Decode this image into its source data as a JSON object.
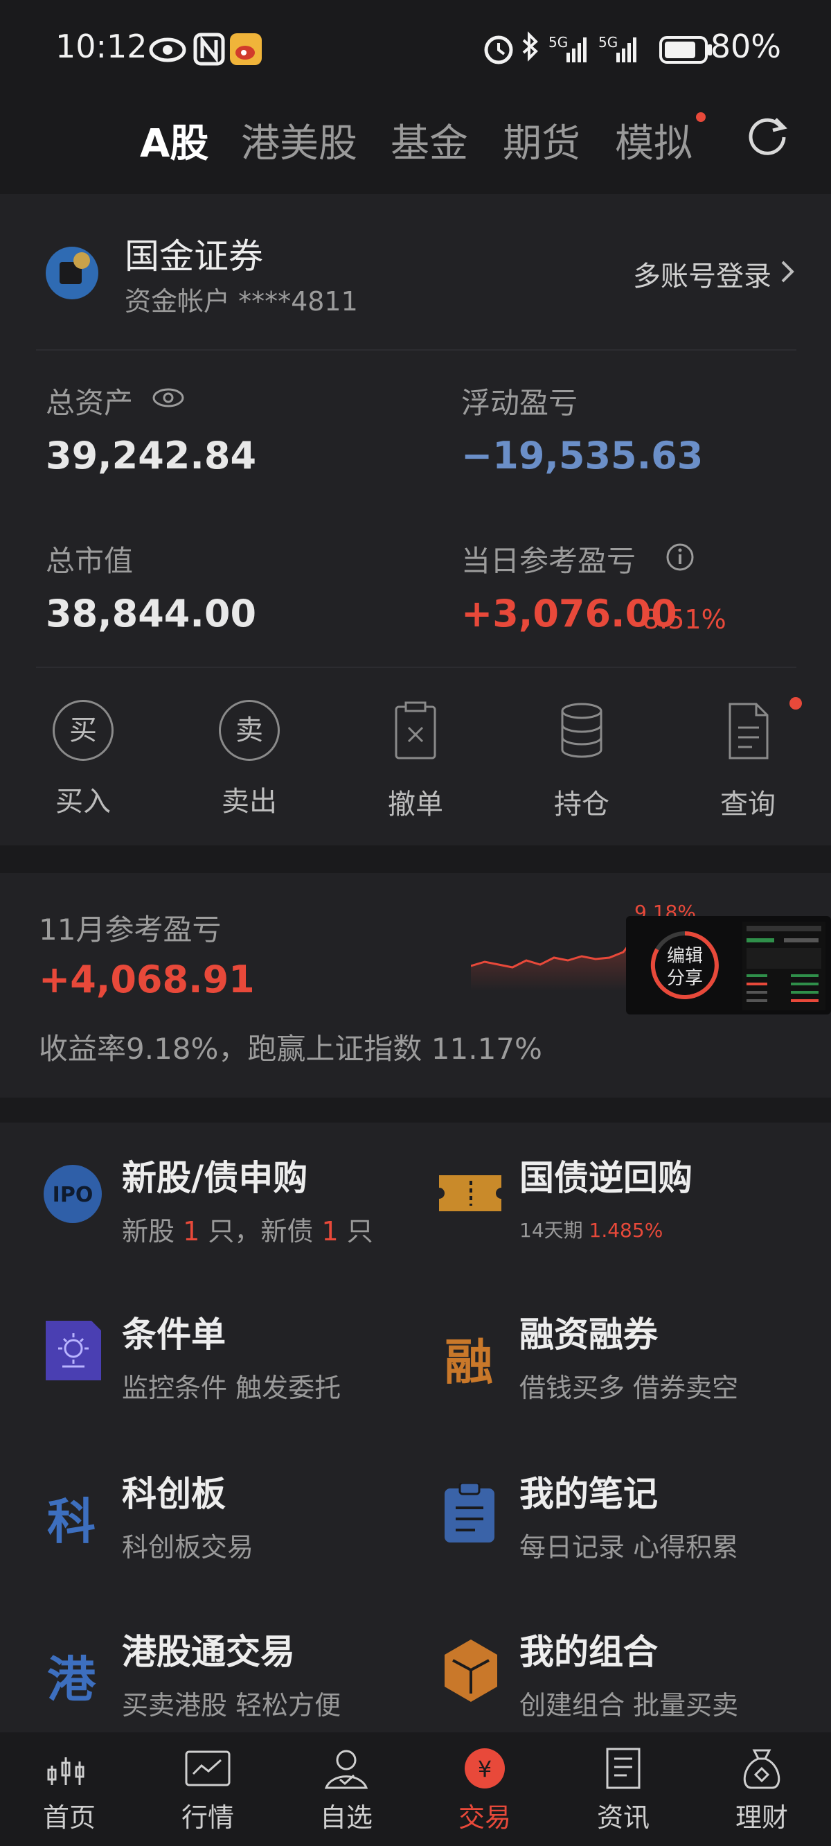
{
  "status_bar": {
    "time": "10:12",
    "battery_text": "80%",
    "network_1": "5G",
    "network_2": "5G"
  },
  "tabs": [
    {
      "label": "A股",
      "active": true
    },
    {
      "label": "港美股",
      "active": false
    },
    {
      "label": "基金",
      "active": false
    },
    {
      "label": "期货",
      "active": false
    },
    {
      "label": "模拟",
      "active": false,
      "has_dot": true
    }
  ],
  "account": {
    "broker": "国金证券",
    "account_label": "资金帐户 ****4811",
    "multi_login": "多账号登录"
  },
  "summary": {
    "total_assets_label": "总资产",
    "total_assets": "39,242.84",
    "floating_pl_label": "浮动盈亏",
    "floating_pl": "−19,535.63",
    "market_value_label": "总市值",
    "market_value": "38,844.00",
    "daily_pl_label": "当日参考盈亏",
    "daily_pl": "+3,076.00",
    "daily_pl_pct": "8.51%"
  },
  "actions": [
    {
      "label": "买入",
      "glyph": "买",
      "icon": "buy-icon"
    },
    {
      "label": "卖出",
      "glyph": "卖",
      "icon": "sell-icon"
    },
    {
      "label": "撤单",
      "icon": "cancel-order-icon"
    },
    {
      "label": "持仓",
      "icon": "holdings-icon"
    },
    {
      "label": "查询",
      "icon": "query-icon",
      "has_dot": true
    }
  ],
  "monthly": {
    "title": "11月参考盈亏",
    "value": "+4,068.91",
    "summary": "收益率9.18%，跑赢上证指数 11.17%",
    "chart_peak_label": "9.18%",
    "share_label": "编辑\n分享"
  },
  "services": [
    {
      "title": "新股/债申购",
      "sub_prefix": "新股 ",
      "sub_n1": "1",
      "sub_mid": " 只，新债 ",
      "sub_n2": "1",
      "sub_suffix": " 只",
      "icon": "ipo-icon",
      "icon_text": "IPO"
    },
    {
      "title": "国债逆回购",
      "sub_small": "14天期 ",
      "sub_rate": "1.485%",
      "icon": "ticket-icon"
    },
    {
      "title": "条件单",
      "sub": "监控条件 触发委托",
      "icon": "condition-order-icon"
    },
    {
      "title": "融资融券",
      "sub": "借钱买多 借券卖空",
      "icon": "margin-icon",
      "icon_text": "融"
    },
    {
      "title": "科创板",
      "sub": "科创板交易",
      "icon": "star-market-icon",
      "icon_text": "科"
    },
    {
      "title": "我的笔记",
      "sub": "每日记录 心得积累",
      "icon": "notes-icon"
    },
    {
      "title": "港股通交易",
      "sub": "买卖港股 轻松方便",
      "icon": "hk-connect-icon",
      "icon_text": "港"
    },
    {
      "title": "我的组合",
      "sub": "创建组合 批量买卖",
      "icon": "portfolio-icon"
    }
  ],
  "bottom_nav": [
    {
      "label": "首页",
      "icon": "home-chart-icon",
      "active": false
    },
    {
      "label": "行情",
      "icon": "market-icon",
      "active": false
    },
    {
      "label": "自选",
      "icon": "watchlist-icon",
      "active": false
    },
    {
      "label": "交易",
      "icon": "trade-icon",
      "active": true
    },
    {
      "label": "资讯",
      "icon": "news-icon",
      "active": false
    },
    {
      "label": "理财",
      "icon": "wealth-icon",
      "active": false
    }
  ],
  "colors": {
    "accent_red": "#e8493a",
    "loss_blue": "#6b8fc8",
    "background": "#1a1a1c",
    "panel": "#222225"
  }
}
